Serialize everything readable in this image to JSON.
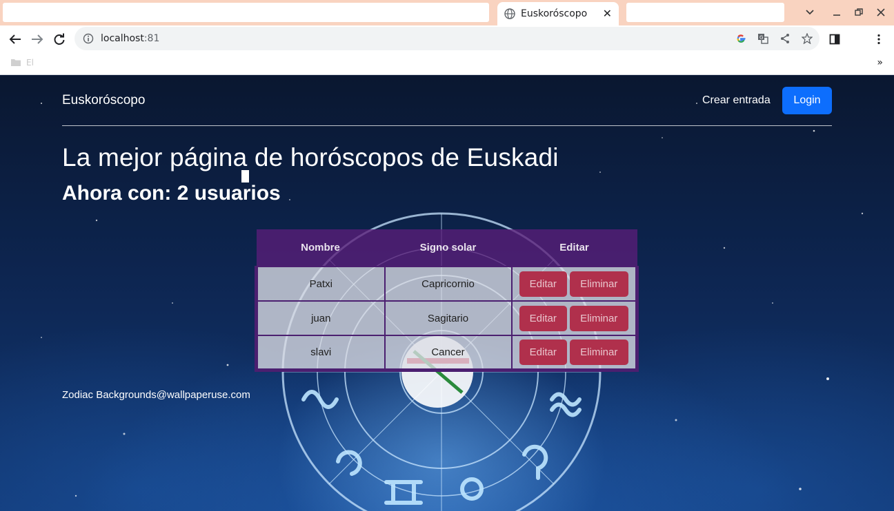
{
  "browser": {
    "tab_title": "Euskoróscopo",
    "url_host": "localhost",
    "url_port": ":81",
    "bookmark_label": "El"
  },
  "page": {
    "brand": "Euskoróscopo",
    "nav_link": "Crear entrada",
    "login_label": "Login",
    "title": "La mejor página de horóscopos de Euskadi",
    "subtitle": "Ahora con: 2 usuarios",
    "credit": "Zodiac Backgrounds@wallpaperuse.com"
  },
  "table": {
    "headers": [
      "Nombre",
      "Signo solar",
      "Editar"
    ],
    "rows": [
      {
        "name": "Patxi",
        "sign": "Capricornio"
      },
      {
        "name": "juan",
        "sign": "Sagitario"
      },
      {
        "name": "slavi",
        "sign": "Cancer"
      }
    ],
    "edit_label": "Editar",
    "delete_label": "Eliminar"
  },
  "icons": {
    "tab": "globe-icon",
    "close": "close-icon",
    "back": "back-arrow-icon",
    "forward": "forward-arrow-icon",
    "reload": "reload-icon",
    "info": "info-icon",
    "google": "google-icon",
    "translate": "translate-icon",
    "share": "share-icon",
    "bookmark": "star-icon",
    "side_panel": "side-panel-icon",
    "menu": "kebab-menu-icon",
    "folder": "folder-icon"
  },
  "colors": {
    "tabstrip": "#f9d3c0",
    "login_button": "#0d6efd",
    "table_header": "#5a1e78",
    "action_button": "#b0304c"
  }
}
